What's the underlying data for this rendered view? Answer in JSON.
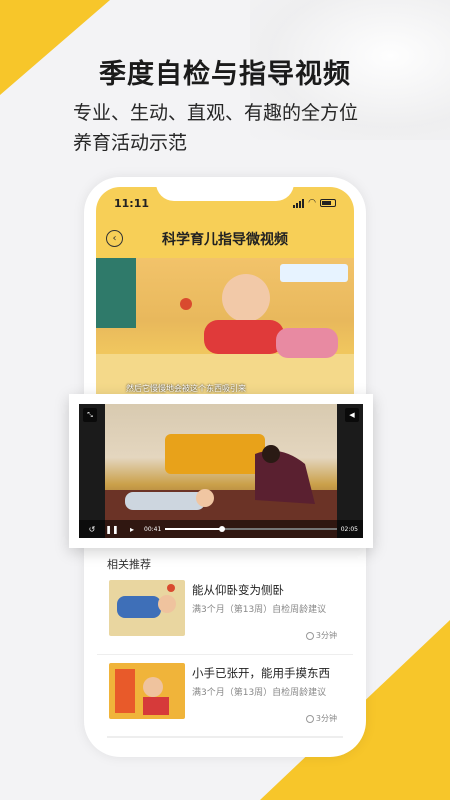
{
  "headline": "季度自检与指导视频",
  "subline_1": "专业、生动、直观、有趣的全方位",
  "subline_2": "养育活动示范",
  "status": {
    "time": "11:11"
  },
  "nav": {
    "back_icon": "chevron-left-icon",
    "title": "科学育儿指导微视频"
  },
  "top_video": {
    "caption": "然后它慢慢地会被这个东西吸引来"
  },
  "player": {
    "elapsed": "00:41",
    "total": "02:05",
    "progress": 0.33
  },
  "recommend": {
    "title": "相关推荐",
    "items": [
      {
        "name": "能从仰卧变为侧卧",
        "sub": "满3个月（第13周）自检周龄建议",
        "duration": "3分钟"
      },
      {
        "name": "小手已张开，能用手摸东西",
        "sub": "满3个月（第13周）自检周龄建议",
        "duration": "3分钟"
      }
    ]
  },
  "colors": {
    "accent": "#f7c62a",
    "header": "#f7cf57"
  }
}
